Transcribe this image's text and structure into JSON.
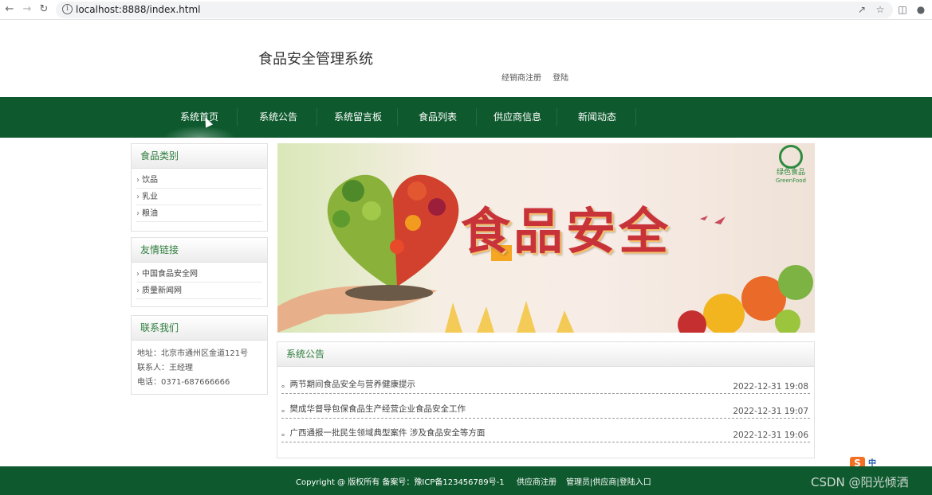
{
  "browser": {
    "url": "localhost:8888/index.html"
  },
  "header": {
    "title": "食品安全管理系统",
    "links": [
      "经销商注册",
      "登陆"
    ]
  },
  "nav": {
    "items": [
      "系统首页",
      "系统公告",
      "系统留言板",
      "食品列表",
      "供应商信息",
      "新闻动态"
    ],
    "active": "系统首页"
  },
  "sidebar": {
    "categories": {
      "title": "食品类别",
      "items": [
        "饮品",
        "乳业",
        "粮油"
      ]
    },
    "links": {
      "title": "友情链接",
      "items": [
        "中国食品安全网",
        "质量新闻网"
      ]
    },
    "contact": {
      "title": "联系我们",
      "address": "地址：北京市通州区金道121号",
      "person": "联系人：王经理",
      "phone": "电话：0371-687666666"
    }
  },
  "banner": {
    "headline": "食品安全",
    "logo_cn": "绿色食品",
    "logo_en": "GreenFood"
  },
  "notices": {
    "title": "系统公告",
    "items": [
      {
        "title": "。两节期间食品安全与营养健康提示",
        "date": "2022-12-31 19:08"
      },
      {
        "title": "。樊成华督导包保食品生产经营企业食品安全工作",
        "date": "2022-12-31 19:07"
      },
      {
        "title": "。广西通报一批民生领域典型案件 涉及食品安全等方面",
        "date": "2022-12-31 19:06"
      }
    ]
  },
  "footer": {
    "copyright": "Copyright @ 版权所有 备案号：豫ICP备123456789号-1",
    "register": "供应商注册",
    "admin": "管理员|供应商|登陆入口"
  },
  "overlay": {
    "watermark": "CSDN @阳光倾洒",
    "ime_logo": "S",
    "ime_mode": "中"
  },
  "colors": {
    "brand_green": "#0e5a2e",
    "heading_green": "#2e7d3c"
  }
}
